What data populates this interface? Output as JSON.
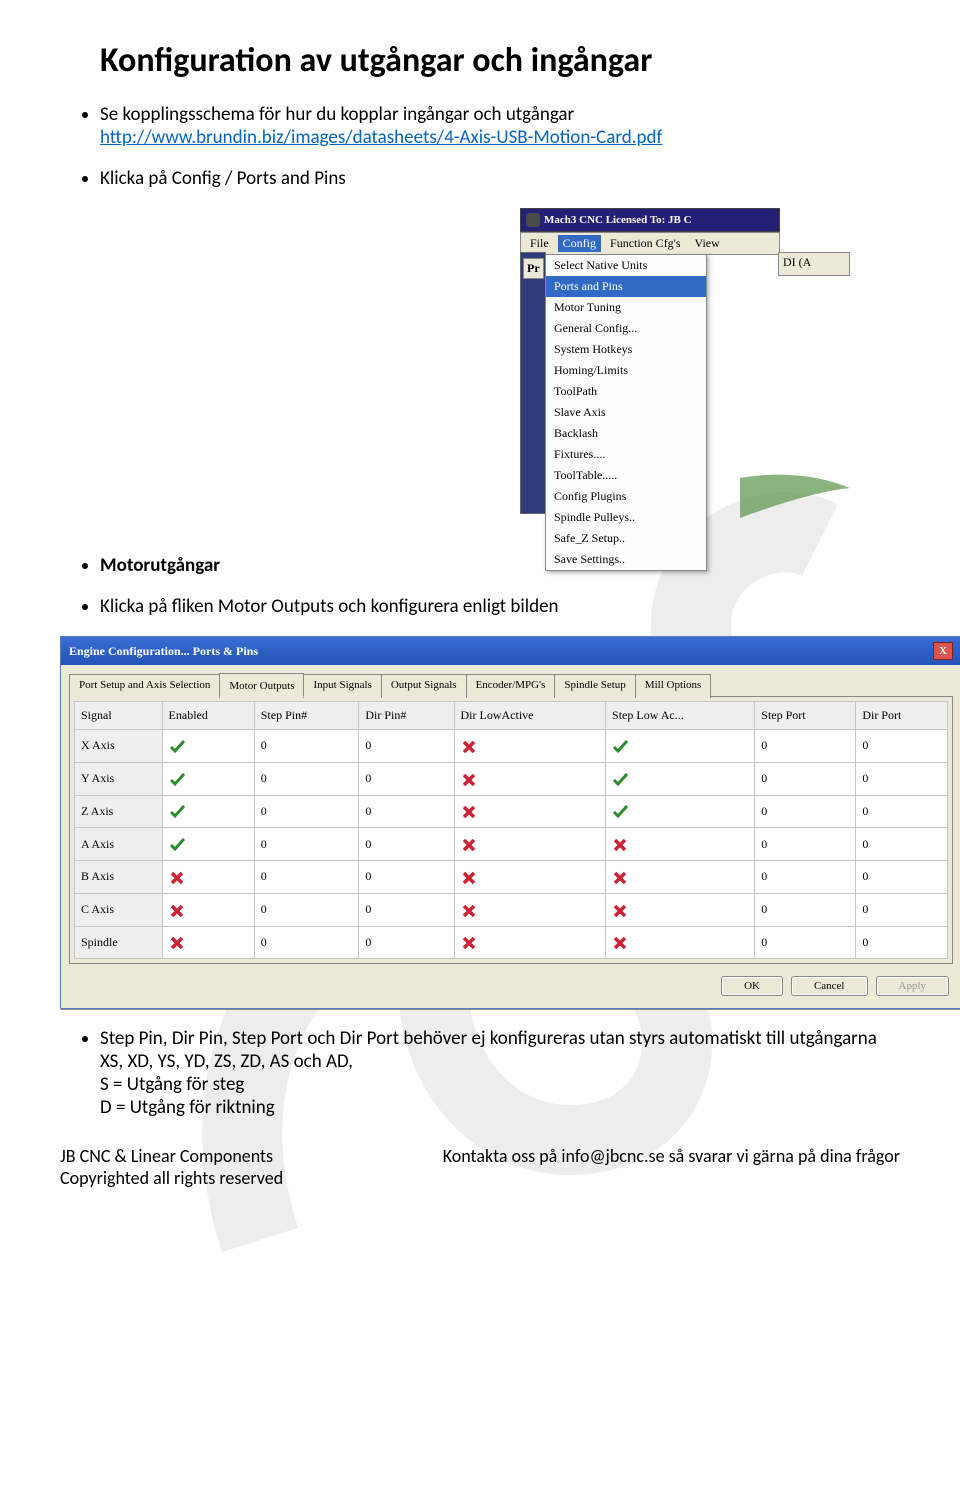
{
  "title": "Konfiguration av utgångar och ingångar",
  "intro_line": "Se kopplingsschema för hur du kopplar ingångar och utgångar",
  "link": "http://www.brundin.biz/images/datasheets/4-Axis-USB-Motion-Card.pdf",
  "bullet_click_config": "Klicka på Config / Ports and Pins",
  "heading_motor": "Motorutgångar",
  "bullet_motor_outputs": "Klicka på fliken Motor Outputs och konfigurera enligt bilden",
  "bullet_step_dir": "Step Pin, Dir Pin, Step Port och Dir Port behöver ej konfigureras utan styrs automatiskt till utgångarna XS, XD, YS, YD, ZS, ZD, AS och AD,",
  "bullet_s": "S = Utgång för steg",
  "bullet_d": "D = Utgång för riktning",
  "mach_window": {
    "title": "Mach3 CNC  Licensed To: JB C",
    "menubar": [
      "File",
      "Config",
      "Function Cfg's",
      "View"
    ],
    "selected_menu": "Config",
    "right_fragment": "DI (A",
    "pr_label": "Pr",
    "config_items": [
      "Select Native Units",
      "Ports and Pins",
      "Motor Tuning",
      "General Config...",
      "System Hotkeys",
      "Homing/Limits",
      "ToolPath",
      "Slave Axis",
      "Backlash",
      "Fixtures....",
      "ToolTable.....",
      "Config Plugins",
      "Spindle Pulleys..",
      "Safe_Z Setup..",
      "Save Settings.."
    ],
    "highlight_index": 1
  },
  "dialog": {
    "title": "Engine Configuration... Ports & Pins",
    "close": "X",
    "tabs": [
      "Port Setup and Axis Selection",
      "Motor Outputs",
      "Input Signals",
      "Output Signals",
      "Encoder/MPG's",
      "Spindle Setup",
      "Mill Options"
    ],
    "active_tab": 1,
    "columns": [
      "Signal",
      "Enabled",
      "Step Pin#",
      "Dir Pin#",
      "Dir LowActive",
      "Step Low Ac...",
      "Step Port",
      "Dir Port"
    ],
    "rows": [
      {
        "signal": "X Axis",
        "enabled": true,
        "step": "0",
        "dir": "0",
        "dla": false,
        "sla": true,
        "sp": "0",
        "dp": "0"
      },
      {
        "signal": "Y Axis",
        "enabled": true,
        "step": "0",
        "dir": "0",
        "dla": false,
        "sla": true,
        "sp": "0",
        "dp": "0"
      },
      {
        "signal": "Z Axis",
        "enabled": true,
        "step": "0",
        "dir": "0",
        "dla": false,
        "sla": true,
        "sp": "0",
        "dp": "0"
      },
      {
        "signal": "A Axis",
        "enabled": true,
        "step": "0",
        "dir": "0",
        "dla": false,
        "sla": false,
        "sp": "0",
        "dp": "0"
      },
      {
        "signal": "B Axis",
        "enabled": false,
        "step": "0",
        "dir": "0",
        "dla": false,
        "sla": false,
        "sp": "0",
        "dp": "0"
      },
      {
        "signal": "C Axis",
        "enabled": false,
        "step": "0",
        "dir": "0",
        "dla": false,
        "sla": false,
        "sp": "0",
        "dp": "0"
      },
      {
        "signal": "Spindle",
        "enabled": false,
        "step": "0",
        "dir": "0",
        "dla": false,
        "sla": false,
        "sp": "0",
        "dp": "0"
      }
    ],
    "buttons": {
      "ok": "OK",
      "cancel": "Cancel",
      "apply": "Apply"
    }
  },
  "footer": {
    "left1": "JB CNC & Linear Components",
    "left2": "Copyrighted all rights reserved",
    "right": "Kontakta oss på info@jbcnc.se så svarar vi gärna på dina frågor"
  }
}
